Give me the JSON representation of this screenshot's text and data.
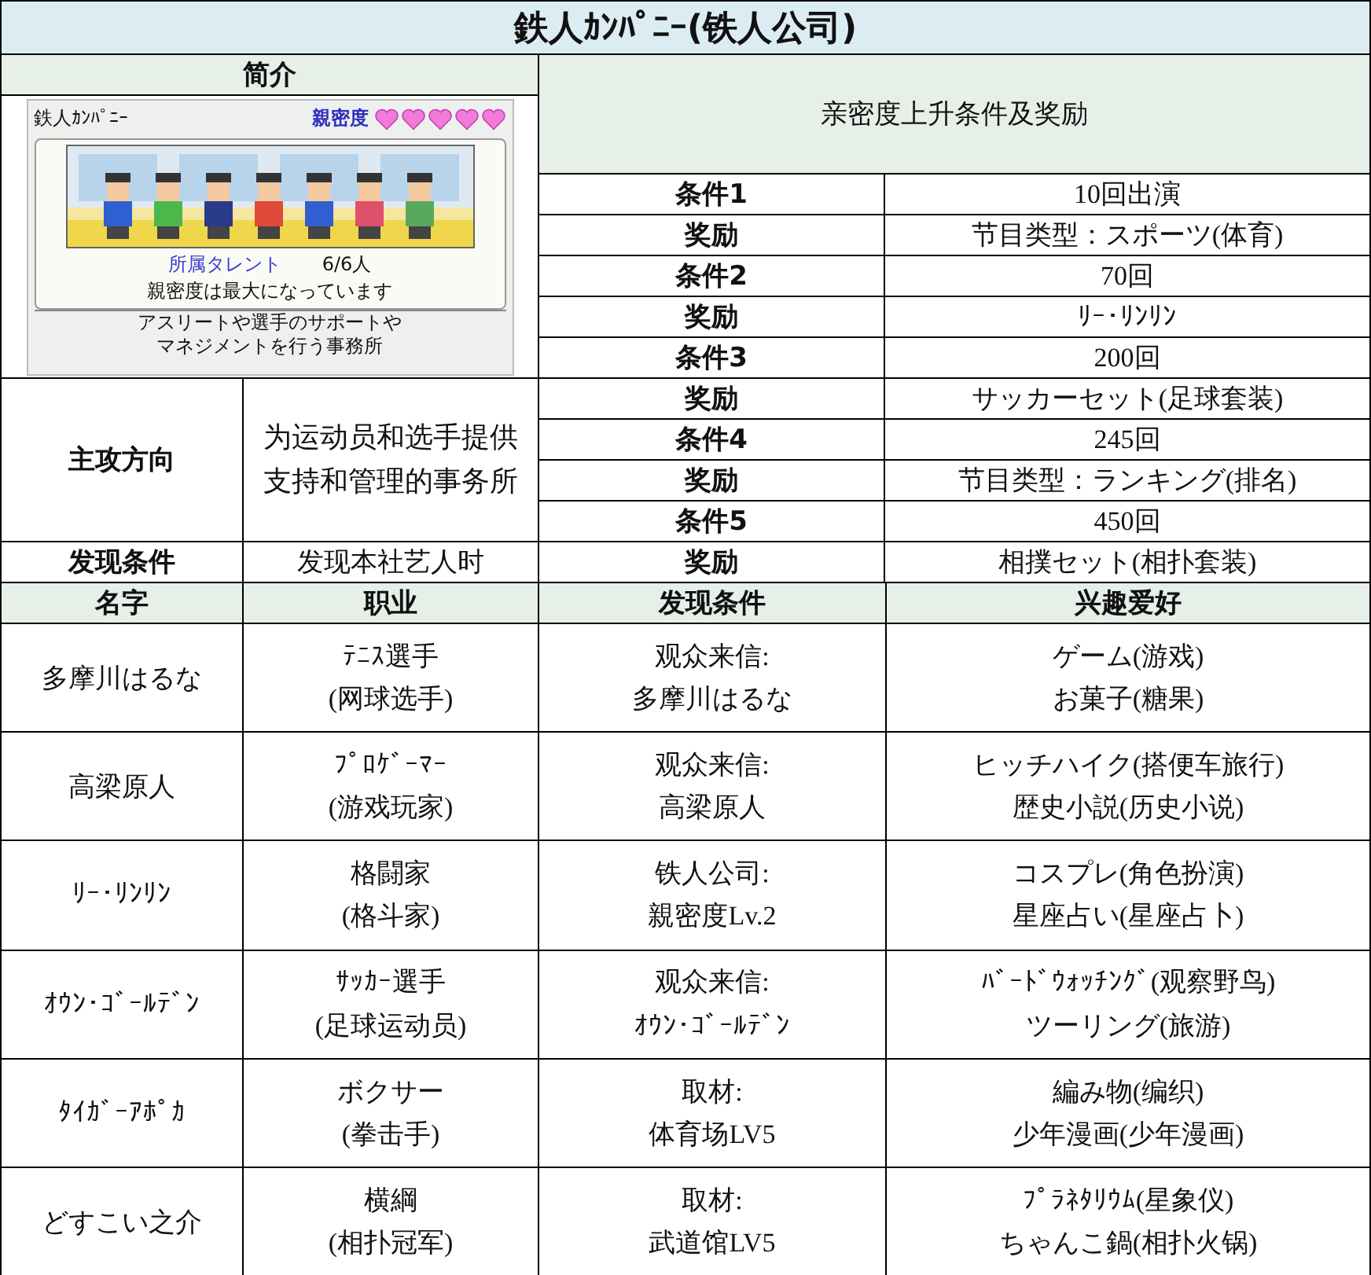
{
  "title": "鉄人ｶﾝﾊﾟﾆｰ(铁人公司)",
  "intro": {
    "header": "简介",
    "game_screen": {
      "company": "鉄人ｶﾝﾊﾟﾆｰ",
      "intimacy_label": "親密度",
      "stars": 5,
      "talent_label": "所属タレント",
      "talent_count": "6/6人",
      "status": "親密度は最大になっています",
      "description": [
        "アスリートや選手のサポートや",
        "マネジメントを行う事務所"
      ]
    },
    "focus_label": "主攻方向",
    "focus_text": "为运动员和选手提供支持和管理的事务所",
    "discover_label": "发现条件",
    "discover_text": "发现本社艺人时"
  },
  "intimacy": {
    "header": "亲密度上升条件及奖励",
    "rows": [
      {
        "label": "条件1",
        "value": "10回出演"
      },
      {
        "label": "奖励",
        "value": "节目类型：スポーツ(体育)"
      },
      {
        "label": "条件2",
        "value": "70回"
      },
      {
        "label": "奖励",
        "value": "ﾘｰ･ﾘﾝﾘﾝ"
      },
      {
        "label": "条件3",
        "value": "200回"
      },
      {
        "label": "奖励",
        "value": "サッカーセット(足球套装)"
      },
      {
        "label": "条件4",
        "value": "245回"
      },
      {
        "label": "奖励",
        "value": "节目类型：ランキング(排名)"
      },
      {
        "label": "条件5",
        "value": "450回"
      },
      {
        "label": "奖励",
        "value": "相撲セット(相扑套装)"
      }
    ]
  },
  "talents": {
    "columns": [
      "名字",
      "职业",
      "发现条件",
      "兴趣爱好"
    ],
    "rows": [
      {
        "name": "多摩川はるな",
        "job": [
          "ﾃﾆｽ選手",
          "(网球选手)"
        ],
        "discover": [
          "观众来信:",
          "多摩川はるな"
        ],
        "hobbies": [
          "ゲーム(游戏)",
          "お菓子(糖果)"
        ]
      },
      {
        "name": "高梁原人",
        "job": [
          "ﾌﾟﾛｹﾞｰﾏｰ",
          "(游戏玩家)"
        ],
        "discover": [
          "观众来信:",
          "高梁原人"
        ],
        "hobbies": [
          "ヒッチハイク(搭便车旅行)",
          "歴史小説(历史小说)"
        ]
      },
      {
        "name": "ﾘｰ･ﾘﾝﾘﾝ",
        "job": [
          "格闘家",
          "(格斗家)"
        ],
        "discover": [
          "铁人公司:",
          "親密度Lv.2"
        ],
        "hobbies": [
          "コスプレ(角色扮演)",
          "星座占い(星座占卜)"
        ]
      },
      {
        "name": "ｵｳﾝ･ｺﾞｰﾙﾃﾞﾝ",
        "job": [
          "ｻｯｶｰ選手",
          "(足球运动员)"
        ],
        "discover": [
          "观众来信:",
          "ｵｳﾝ･ｺﾞｰﾙﾃﾞﾝ"
        ],
        "hobbies": [
          "ﾊﾞｰﾄﾞｳｫｯﾁﾝｸﾞ(观察野鸟)",
          "ツーリング(旅游)"
        ]
      },
      {
        "name": "ﾀｲｶﾞｰｱﾎﾟｶ",
        "job": [
          "ボクサー",
          "(拳击手)"
        ],
        "discover": [
          "取材:",
          "体育场LV5"
        ],
        "hobbies": [
          "編み物(编织)",
          "少年漫画(少年漫画)"
        ]
      },
      {
        "name": "どすこい之介",
        "job": [
          "横綱",
          "(相扑冠军)"
        ],
        "discover": [
          "取材:",
          "武道馆LV5"
        ],
        "hobbies": [
          "ﾌﾟﾗﾈﾀﾘｳﾑ(星象仪)",
          "ちゃんこ鍋(相扑火锅)"
        ]
      }
    ]
  }
}
